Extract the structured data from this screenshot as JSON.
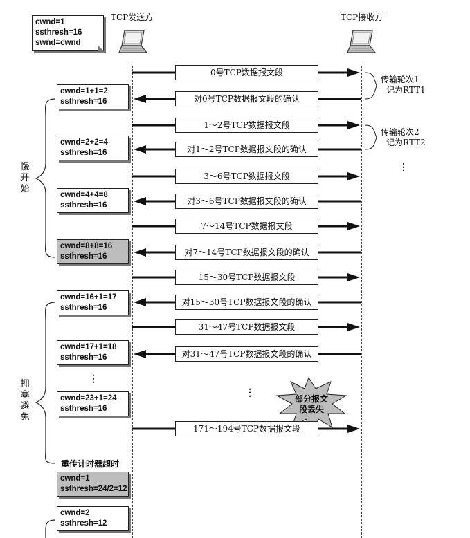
{
  "sender_label": "TCP发送方",
  "receiver_label": "TCP接收方",
  "initial_note": [
    "cwnd=1",
    "ssthresh=16",
    "swnd=cwnd"
  ],
  "state_notes": [
    [
      "cwnd=1+1=2",
      "ssthresh=16"
    ],
    [
      "cwnd=2+2=4",
      "ssthresh=16"
    ],
    [
      "cwnd=4+4=8",
      "ssthresh=16"
    ],
    [
      "cwnd=8+8=16",
      "ssthresh=16"
    ],
    [
      "cwnd=16+1=17",
      "ssthresh=16"
    ],
    [
      "cwnd=17+1=18",
      "ssthresh=16"
    ],
    [
      "cwnd=23+1=24",
      "ssthresh=16"
    ],
    [
      "cwnd=1",
      "ssthresh=24/2=12"
    ],
    [
      "cwnd=2",
      "ssthresh=12"
    ]
  ],
  "messages": [
    {
      "text": "0号TCP数据报文段",
      "dir": "right"
    },
    {
      "text": "对0号TCP数据报文段的确认",
      "dir": "left"
    },
    {
      "text": "1～2号TCP数据报文段",
      "dir": "right"
    },
    {
      "text": "对1～2号TCP数据报文段的确认",
      "dir": "left"
    },
    {
      "text": "3～6号TCP数据报文段",
      "dir": "right"
    },
    {
      "text": "对3～6号TCP数据报文段的确认",
      "dir": "left"
    },
    {
      "text": "7～14号TCP数据报文段",
      "dir": "right"
    },
    {
      "text": "对7～14号TCP数据报文段的确认",
      "dir": "left"
    },
    {
      "text": "15～30号TCP数据报文段",
      "dir": "right"
    },
    {
      "text": "对15～30号TCP数据报文段的确认",
      "dir": "left"
    },
    {
      "text": "31～47号TCP数据报文段",
      "dir": "right"
    },
    {
      "text": "对31～47号TCP数据报文段的确认",
      "dir": "left"
    },
    {
      "text": "171～194号TCP数据报文段",
      "dir": "right"
    }
  ],
  "phase_slow_start": [
    "慢",
    "开",
    "始"
  ],
  "phase_congestion_avoidance": [
    "拥",
    "塞",
    "避",
    "免"
  ],
  "round_annotations": [
    [
      "传输轮次1",
      "记为RTT1"
    ],
    [
      "传输轮次2",
      "记为RTT2"
    ]
  ],
  "packet_loss_label": [
    "部分报文",
    "段丢失"
  ],
  "timeout_label": "重传计时器超时",
  "ellipsis": "⋮"
}
